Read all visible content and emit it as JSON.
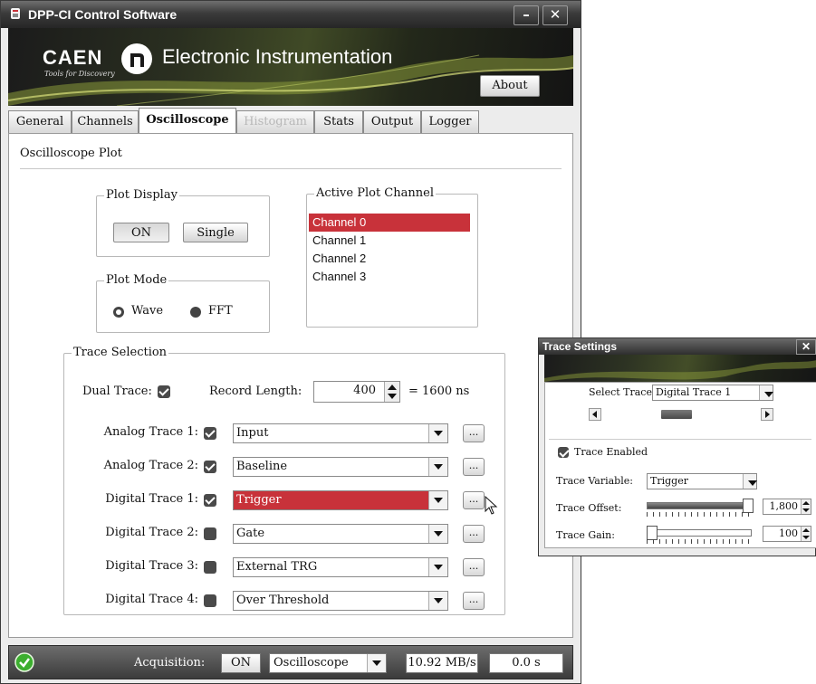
{
  "window": {
    "title": "DPP-CI Control Software",
    "minimize": "–",
    "close": "✕"
  },
  "banner": {
    "brand": "CAEN",
    "tagline": "Tools for Discovery",
    "product": "Electronic Instrumentation",
    "about": "About"
  },
  "tabs": [
    {
      "label": "General",
      "active": false,
      "disabled": false
    },
    {
      "label": "Channels",
      "active": false,
      "disabled": false
    },
    {
      "label": "Oscilloscope",
      "active": true,
      "disabled": false
    },
    {
      "label": "Histogram",
      "active": false,
      "disabled": true
    },
    {
      "label": "Stats",
      "active": false,
      "disabled": false
    },
    {
      "label": "Output",
      "active": false,
      "disabled": false
    },
    {
      "label": "Logger",
      "active": false,
      "disabled": false
    }
  ],
  "oscilloscope": {
    "section_title": "Oscilloscope Plot",
    "plot_display": {
      "legend": "Plot Display",
      "on": "ON",
      "single": "Single"
    },
    "plot_mode": {
      "legend": "Plot Mode",
      "wave": "Wave",
      "fft": "FFT",
      "selected": "Wave"
    },
    "active_channel": {
      "legend": "Active Plot  Channel",
      "items": [
        "Channel 0",
        "Channel 1",
        "Channel 2",
        "Channel 3"
      ],
      "selected": "Channel 0"
    },
    "trace_selection": {
      "legend": "Trace Selection",
      "dual_trace_label": "Dual Trace:",
      "dual_trace": true,
      "record_length_label": "Record Length:",
      "record_length": "400",
      "record_length_ns": "= 1600 ns",
      "ellipsis": "...",
      "rows": [
        {
          "label": "Analog Trace 1:",
          "checked": true,
          "value": "Input",
          "highlight": false
        },
        {
          "label": "Analog Trace 2:",
          "checked": true,
          "value": "Baseline",
          "highlight": false
        },
        {
          "label": "Digital Trace 1:",
          "checked": true,
          "value": "Trigger",
          "highlight": true
        },
        {
          "label": "Digital Trace 2:",
          "checked": false,
          "value": "Gate",
          "highlight": false
        },
        {
          "label": "Digital Trace 3:",
          "checked": false,
          "value": "External TRG",
          "highlight": false
        },
        {
          "label": "Digital Trace 4:",
          "checked": false,
          "value": "Over Threshold",
          "highlight": false
        }
      ]
    }
  },
  "statusbar": {
    "acquisition_label": "Acquisition:",
    "on": "ON",
    "mode": "Oscilloscope",
    "rate": "10.92 MB/s",
    "time": "0.0 s"
  },
  "trace_settings": {
    "title": "Trace Settings",
    "close": "✕",
    "select_trace_label": "Select Trace:",
    "select_trace": "Digital Trace 1",
    "trace_enabled_label": "Trace Enabled",
    "trace_enabled": true,
    "trace_variable_label": "Trace Variable:",
    "trace_variable": "Trigger",
    "trace_offset_label": "Trace Offset:",
    "trace_offset": "1,800",
    "trace_offset_level": 0.97,
    "trace_gain_label": "Trace Gain:",
    "trace_gain": "100",
    "trace_gain_level": 0.0
  },
  "colors": {
    "accent_red": "#c8323a",
    "status_ok_green": "#3cae2f"
  }
}
